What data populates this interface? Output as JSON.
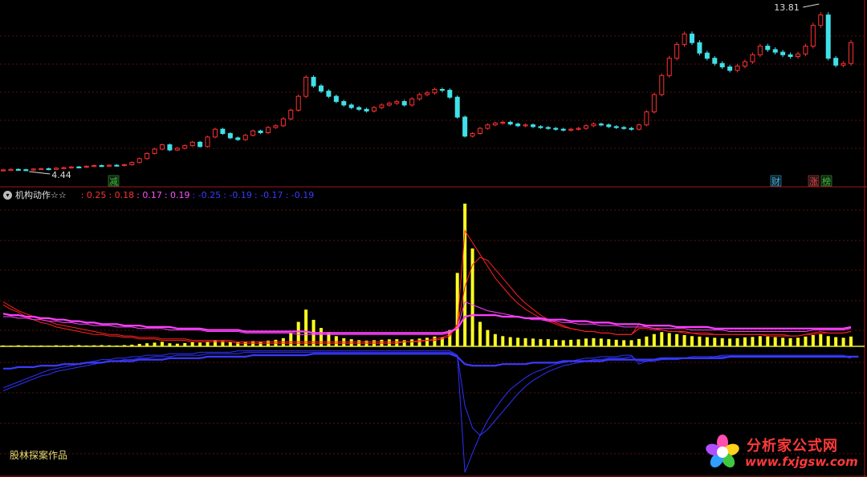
{
  "indicator": {
    "name": "机构动作☆☆",
    "values": [
      {
        "text": ": 0.25",
        "color": "#ff3030"
      },
      {
        "text": ": 0.18",
        "color": "#ff3030"
      },
      {
        "text": ": 0.17",
        "color": "#ff50ff"
      },
      {
        "text": ": 0.19",
        "color": "#ff50ff"
      },
      {
        "text": ": -0.25",
        "color": "#3a3aff"
      },
      {
        "text": ": -0.19",
        "color": "#3a3aff"
      },
      {
        "text": ": -0.17",
        "color": "#3a3aff"
      },
      {
        "text": ": -0.19",
        "color": "#3a3aff"
      }
    ]
  },
  "credit": "股林探案作品",
  "watermark": {
    "title": "分析家公式网",
    "url": "www.fxjgsw.com"
  },
  "chart_data": [
    {
      "type": "candlestick",
      "price_labels": {
        "high": "13.81",
        "low": "4.44"
      },
      "markers": [
        {
          "label": "减",
          "color": "#30d030"
        },
        {
          "label": "财",
          "color": "#30c0ff"
        },
        {
          "label": "涨",
          "color": "#ff4040"
        },
        {
          "label": "榜",
          "color": "#30d030"
        }
      ],
      "close": [
        4.45,
        4.48,
        4.46,
        4.44,
        4.5,
        4.52,
        4.48,
        4.55,
        4.58,
        4.62,
        4.6,
        4.66,
        4.7,
        4.68,
        4.72,
        4.7,
        4.75,
        4.88,
        5.1,
        5.4,
        5.65,
        5.9,
        5.6,
        5.7,
        5.85,
        6.05,
        5.8,
        6.35,
        6.8,
        6.55,
        6.3,
        6.2,
        6.45,
        6.7,
        6.6,
        6.9,
        7.0,
        7.4,
        7.9,
        8.7,
        9.8,
        9.3,
        9.0,
        8.7,
        8.4,
        8.2,
        8.05,
        7.95,
        7.85,
        8.05,
        8.2,
        8.3,
        8.4,
        8.2,
        8.55,
        8.8,
        8.9,
        9.1,
        9.05,
        8.65,
        7.5,
        6.4,
        6.55,
        6.85,
        7.05,
        7.15,
        7.2,
        7.1,
        7.0,
        7.05,
        6.95,
        6.9,
        6.85,
        6.8,
        6.75,
        6.8,
        6.85,
        7.0,
        7.1,
        7.05,
        6.95,
        6.9,
        6.85,
        6.8,
        7.05,
        7.8,
        8.8,
        9.9,
        10.9,
        11.7,
        12.3,
        11.8,
        11.2,
        10.9,
        10.6,
        10.4,
        10.2,
        10.45,
        10.7,
        11.1,
        11.6,
        11.4,
        11.25,
        11.1,
        11.0,
        11.15,
        11.6,
        12.8,
        13.4,
        10.9,
        10.5,
        10.6,
        11.8
      ],
      "volume": [
        0.4,
        0.3,
        0.5,
        0.4,
        0.3,
        0.4,
        0.3,
        0.5,
        0.4,
        0.5,
        0.6,
        0.4,
        0.5,
        0.6,
        0.5,
        0.4,
        0.6,
        0.8,
        1.2,
        1.5,
        1.8,
        2.2,
        1.5,
        1.3,
        1.6,
        2.0,
        1.8,
        2.4,
        3.0,
        2.6,
        2.2,
        2.0,
        2.3,
        2.6,
        2.4,
        2.8,
        3.2,
        4.0,
        6.5,
        12.0,
        18.0,
        13.0,
        9.0,
        7.0,
        5.0,
        4.0,
        3.5,
        3.0,
        2.8,
        3.0,
        3.2,
        3.4,
        3.5,
        3.0,
        3.4,
        3.8,
        4.2,
        4.8,
        4.4,
        8.0,
        36.0,
        70.0,
        48.0,
        12.0,
        8.0,
        6.0,
        5.0,
        4.5,
        4.2,
        4.0,
        3.8,
        3.5,
        3.5,
        3.2,
        3.0,
        3.2,
        3.4,
        3.8,
        4.0,
        3.8,
        3.5,
        3.2,
        3.0,
        3.0,
        3.6,
        4.8,
        6.0,
        7.0,
        6.5,
        6.0,
        5.5,
        5.0,
        4.8,
        4.5,
        4.2,
        4.0,
        3.8,
        4.0,
        4.4,
        4.6,
        5.0,
        4.8,
        4.5,
        4.2,
        4.0,
        4.2,
        4.8,
        5.5,
        6.0,
        5.0,
        4.5,
        4.2,
        4.8
      ]
    },
    {
      "type": "line",
      "series": [
        {
          "color": "#ff2020",
          "values": [
            0.28,
            0.25,
            0.23,
            0.2,
            0.18,
            0.16,
            0.15,
            0.13,
            0.12,
            0.11,
            0.1,
            0.09,
            0.08,
            0.08,
            0.07,
            0.07,
            0.06,
            0.06,
            0.05,
            0.05,
            0.05,
            0.04,
            0.04,
            0.04,
            0.04,
            0.03,
            0.03,
            0.03,
            0.03,
            0.03,
            0.03,
            0.02,
            0.02,
            0.02,
            0.02,
            0.02,
            0.02,
            0.02,
            0.02,
            0.02,
            0.02,
            0.02,
            0.02,
            0.02,
            0.02,
            0.02,
            0.02,
            0.02,
            0.02,
            0.02,
            0.02,
            0.02,
            0.02,
            0.03,
            0.03,
            0.03,
            0.04,
            0.04,
            0.05,
            0.07,
            0.15,
            0.78,
            0.7,
            0.62,
            0.54,
            0.46,
            0.4,
            0.34,
            0.29,
            0.25,
            0.22,
            0.19,
            0.17,
            0.15,
            0.13,
            0.12,
            0.11,
            0.1,
            0.1,
            0.09,
            0.09,
            0.08,
            0.08,
            0.08,
            0.15,
            0.13,
            0.12,
            0.11,
            0.1,
            0.1,
            0.09,
            0.09,
            0.08,
            0.08,
            0.08,
            0.08,
            0.08,
            0.08,
            0.08,
            0.08,
            0.08,
            0.07,
            0.07,
            0.07,
            0.07,
            0.07,
            0.08,
            0.09,
            0.1,
            0.09,
            0.09,
            0.09,
            0.1
          ]
        },
        {
          "color": "#ff2020",
          "values": [
            0.3,
            0.27,
            0.24,
            0.22,
            0.2,
            0.18,
            0.17,
            0.15,
            0.14,
            0.13,
            0.12,
            0.11,
            0.1,
            0.09,
            0.08,
            0.08,
            0.07,
            0.07,
            0.06,
            0.06,
            0.06,
            0.05,
            0.05,
            0.05,
            0.05,
            0.04,
            0.04,
            0.04,
            0.04,
            0.04,
            0.04,
            0.03,
            0.03,
            0.03,
            0.03,
            0.03,
            0.03,
            0.03,
            0.03,
            0.03,
            0.03,
            0.03,
            0.03,
            0.03,
            0.03,
            0.03,
            0.03,
            0.03,
            0.03,
            0.03,
            0.03,
            0.03,
            0.03,
            0.03,
            0.03,
            0.04,
            0.04,
            0.05,
            0.06,
            0.08,
            0.14,
            0.4,
            0.55,
            0.6,
            0.58,
            0.52,
            0.46,
            0.4,
            0.34,
            0.29,
            0.25,
            0.21,
            0.18,
            0.16,
            0.14,
            0.12,
            0.11,
            0.1,
            0.1,
            0.09,
            0.09,
            0.08,
            0.08,
            0.08,
            0.12,
            0.12,
            0.11,
            0.11,
            0.1,
            0.1,
            0.1,
            0.09,
            0.09,
            0.09,
            0.08,
            0.08,
            0.08,
            0.08,
            0.08,
            0.08,
            0.08,
            0.08,
            0.08,
            0.08,
            0.07,
            0.07,
            0.08,
            0.08,
            0.09,
            0.09,
            0.09,
            0.09,
            0.1
          ]
        },
        {
          "color": "#ff40ff",
          "values": [
            0.2,
            0.2,
            0.19,
            0.19,
            0.18,
            0.18,
            0.17,
            0.17,
            0.16,
            0.16,
            0.15,
            0.15,
            0.14,
            0.14,
            0.14,
            0.13,
            0.13,
            0.13,
            0.12,
            0.12,
            0.12,
            0.12,
            0.11,
            0.11,
            0.11,
            0.11,
            0.11,
            0.1,
            0.1,
            0.1,
            0.1,
            0.1,
            0.09,
            0.09,
            0.09,
            0.09,
            0.09,
            0.09,
            0.09,
            0.08,
            0.08,
            0.08,
            0.08,
            0.08,
            0.08,
            0.08,
            0.08,
            0.08,
            0.08,
            0.08,
            0.08,
            0.08,
            0.08,
            0.08,
            0.08,
            0.08,
            0.08,
            0.08,
            0.08,
            0.09,
            0.12,
            0.3,
            0.28,
            0.26,
            0.24,
            0.23,
            0.22,
            0.21,
            0.2,
            0.19,
            0.18,
            0.18,
            0.17,
            0.17,
            0.16,
            0.16,
            0.15,
            0.15,
            0.15,
            0.14,
            0.14,
            0.14,
            0.13,
            0.13,
            0.13,
            0.13,
            0.12,
            0.12,
            0.12,
            0.12,
            0.12,
            0.11,
            0.11,
            0.11,
            0.11,
            0.11,
            0.1,
            0.1,
            0.1,
            0.1,
            0.1,
            0.1,
            0.1,
            0.1,
            0.1,
            0.1,
            0.1,
            0.11,
            0.11,
            0.11,
            0.11,
            0.11,
            0.12
          ]
        },
        {
          "color": "#ff40ff",
          "values": [
            0.22,
            0.21,
            0.21,
            0.2,
            0.2,
            0.19,
            0.19,
            0.18,
            0.18,
            0.17,
            0.17,
            0.16,
            0.16,
            0.15,
            0.15,
            0.15,
            0.14,
            0.14,
            0.14,
            0.13,
            0.13,
            0.13,
            0.13,
            0.12,
            0.12,
            0.12,
            0.12,
            0.11,
            0.11,
            0.11,
            0.11,
            0.11,
            0.1,
            0.1,
            0.1,
            0.1,
            0.1,
            0.1,
            0.1,
            0.1,
            0.1,
            0.09,
            0.09,
            0.09,
            0.09,
            0.09,
            0.09,
            0.09,
            0.09,
            0.09,
            0.09,
            0.09,
            0.09,
            0.09,
            0.09,
            0.09,
            0.09,
            0.09,
            0.09,
            0.1,
            0.12,
            0.2,
            0.21,
            0.21,
            0.21,
            0.21,
            0.2,
            0.2,
            0.2,
            0.19,
            0.19,
            0.19,
            0.18,
            0.18,
            0.18,
            0.17,
            0.17,
            0.17,
            0.16,
            0.16,
            0.16,
            0.15,
            0.15,
            0.15,
            0.15,
            0.14,
            0.14,
            0.14,
            0.14,
            0.13,
            0.13,
            0.13,
            0.13,
            0.13,
            0.12,
            0.12,
            0.12,
            0.12,
            0.12,
            0.12,
            0.12,
            0.12,
            0.12,
            0.12,
            0.12,
            0.12,
            0.12,
            0.12,
            0.12,
            0.12,
            0.12,
            0.12,
            0.13
          ]
        },
        {
          "color": "#3030ff",
          "values": [
            -0.28,
            -0.26,
            -0.24,
            -0.22,
            -0.2,
            -0.18,
            -0.16,
            -0.15,
            -0.14,
            -0.13,
            -0.12,
            -0.11,
            -0.1,
            -0.09,
            -0.09,
            -0.08,
            -0.08,
            -0.07,
            -0.07,
            -0.06,
            -0.06,
            -0.06,
            -0.05,
            -0.05,
            -0.05,
            -0.05,
            -0.04,
            -0.04,
            -0.04,
            -0.04,
            -0.04,
            -0.03,
            -0.03,
            -0.03,
            -0.03,
            -0.03,
            -0.03,
            -0.03,
            -0.03,
            -0.03,
            -0.03,
            -0.03,
            -0.03,
            -0.03,
            -0.03,
            -0.03,
            -0.03,
            -0.03,
            -0.03,
            -0.03,
            -0.03,
            -0.03,
            -0.03,
            -0.03,
            -0.03,
            -0.03,
            -0.03,
            -0.03,
            -0.03,
            -0.03,
            -0.06,
            -0.85,
            -0.72,
            -0.6,
            -0.5,
            -0.42,
            -0.35,
            -0.29,
            -0.25,
            -0.21,
            -0.18,
            -0.16,
            -0.14,
            -0.12,
            -0.11,
            -0.1,
            -0.09,
            -0.08,
            -0.08,
            -0.07,
            -0.07,
            -0.07,
            -0.06,
            -0.06,
            -0.12,
            -0.1,
            -0.09,
            -0.09,
            -0.08,
            -0.08,
            -0.08,
            -0.07,
            -0.07,
            -0.07,
            -0.07,
            -0.06,
            -0.06,
            -0.06,
            -0.06,
            -0.06,
            -0.06,
            -0.06,
            -0.06,
            -0.06,
            -0.06,
            -0.06,
            -0.06,
            -0.06,
            -0.06,
            -0.06,
            -0.06,
            -0.06,
            -0.08
          ]
        },
        {
          "color": "#3030ff",
          "values": [
            -0.3,
            -0.28,
            -0.26,
            -0.24,
            -0.22,
            -0.2,
            -0.19,
            -0.17,
            -0.16,
            -0.15,
            -0.14,
            -0.13,
            -0.12,
            -0.11,
            -0.1,
            -0.1,
            -0.09,
            -0.09,
            -0.08,
            -0.08,
            -0.07,
            -0.07,
            -0.07,
            -0.06,
            -0.06,
            -0.06,
            -0.06,
            -0.05,
            -0.05,
            -0.05,
            -0.05,
            -0.05,
            -0.04,
            -0.04,
            -0.04,
            -0.04,
            -0.04,
            -0.04,
            -0.04,
            -0.04,
            -0.04,
            -0.04,
            -0.04,
            -0.04,
            -0.04,
            -0.04,
            -0.04,
            -0.04,
            -0.04,
            -0.04,
            -0.04,
            -0.04,
            -0.04,
            -0.04,
            -0.04,
            -0.04,
            -0.04,
            -0.04,
            -0.04,
            -0.04,
            -0.06,
            -0.4,
            -0.55,
            -0.6,
            -0.56,
            -0.5,
            -0.44,
            -0.38,
            -0.32,
            -0.27,
            -0.23,
            -0.2,
            -0.17,
            -0.15,
            -0.13,
            -0.12,
            -0.11,
            -0.1,
            -0.09,
            -0.09,
            -0.08,
            -0.08,
            -0.08,
            -0.07,
            -0.1,
            -0.1,
            -0.1,
            -0.09,
            -0.09,
            -0.09,
            -0.08,
            -0.08,
            -0.08,
            -0.08,
            -0.07,
            -0.07,
            -0.07,
            -0.07,
            -0.07,
            -0.07,
            -0.07,
            -0.07,
            -0.07,
            -0.07,
            -0.07,
            -0.07,
            -0.07,
            -0.07,
            -0.07,
            -0.07,
            -0.07,
            -0.07,
            -0.08
          ]
        },
        {
          "color": "#3a3aff",
          "values": [
            -0.15,
            -0.15,
            -0.14,
            -0.14,
            -0.14,
            -0.13,
            -0.13,
            -0.13,
            -0.12,
            -0.12,
            -0.12,
            -0.11,
            -0.11,
            -0.11,
            -0.1,
            -0.1,
            -0.1,
            -0.1,
            -0.09,
            -0.09,
            -0.09,
            -0.09,
            -0.08,
            -0.08,
            -0.08,
            -0.08,
            -0.08,
            -0.07,
            -0.07,
            -0.07,
            -0.07,
            -0.07,
            -0.07,
            -0.06,
            -0.06,
            -0.06,
            -0.06,
            -0.06,
            -0.06,
            -0.06,
            -0.06,
            -0.05,
            -0.05,
            -0.05,
            -0.05,
            -0.05,
            -0.05,
            -0.05,
            -0.05,
            -0.05,
            -0.05,
            -0.05,
            -0.05,
            -0.05,
            -0.05,
            -0.05,
            -0.05,
            -0.05,
            -0.05,
            -0.05,
            -0.07,
            -0.12,
            -0.13,
            -0.13,
            -0.13,
            -0.13,
            -0.12,
            -0.12,
            -0.12,
            -0.12,
            -0.11,
            -0.11,
            -0.11,
            -0.11,
            -0.1,
            -0.1,
            -0.1,
            -0.1,
            -0.1,
            -0.1,
            -0.09,
            -0.09,
            -0.09,
            -0.09,
            -0.09,
            -0.09,
            -0.09,
            -0.08,
            -0.08,
            -0.08,
            -0.08,
            -0.08,
            -0.08,
            -0.08,
            -0.08,
            -0.08,
            -0.07,
            -0.07,
            -0.07,
            -0.07,
            -0.07,
            -0.07,
            -0.07,
            -0.07,
            -0.07,
            -0.07,
            -0.07,
            -0.07,
            -0.07,
            -0.07,
            -0.07,
            -0.07,
            -0.07,
            -0.07
          ]
        }
      ]
    }
  ]
}
